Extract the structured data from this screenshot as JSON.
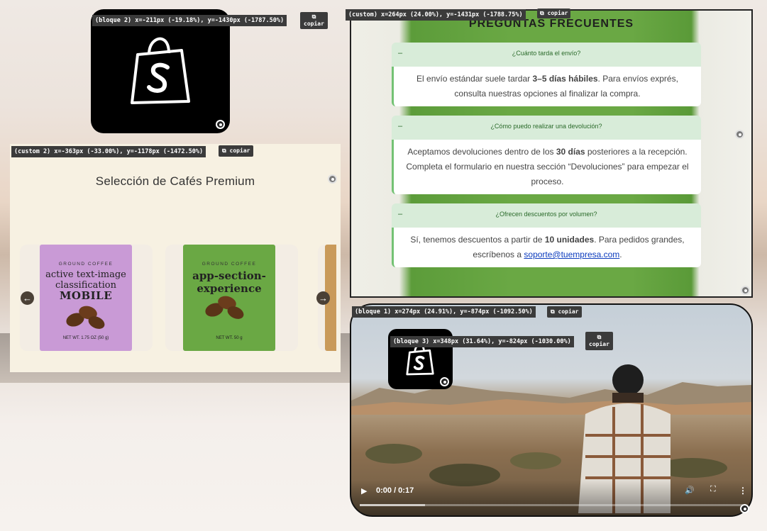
{
  "tags": {
    "logo_top": "(bloque 2) x=-211px (-19.18%), y=-1430px (-1787.50%)",
    "faq": "(custom) x=264px (24.00%), y=-1431px (-1788.75%)",
    "carousel": "(custom 2) x=-363px (-33.00%), y=-1178px (-1472.50%)",
    "video": "(bloque 1) x=274px (24.91%), y=-874px (-1092.50%)",
    "logo_small": "(bloque 3) x=348px (31.64%), y=-824px (-1030.00%)"
  },
  "copy_label": "copiar",
  "copy_icon": "⧉",
  "carousel": {
    "title": "Selección de Cafés Premium",
    "prev": "←",
    "next": "→",
    "products": [
      {
        "brand": "GROUND COFFEE",
        "line1": "active text-image",
        "line2": "classification",
        "line3": "MOBILE",
        "weight": "NET WT. 1.75 OZ (50 g)",
        "color": "#c99ad6"
      },
      {
        "brand": "GROUND COFFEE",
        "line1": "app-section-",
        "line2": "experience",
        "line3": "",
        "weight": "NET WT. 50 g",
        "color": "#6aa844"
      }
    ]
  },
  "faq": {
    "heading": "PREGUNTAS FRECUENTES",
    "items": [
      {
        "q": "¿Cuánto tarda el envío?",
        "a_pre": "El envío estándar suele tardar ",
        "a_bold": "3–5 días hábiles",
        "a_post": ". Para envíos exprés, consulta nuestras opciones al finalizar la compra."
      },
      {
        "q": "¿Cómo puedo realizar una devolución?",
        "a_pre": "Aceptamos devoluciones dentro de los ",
        "a_bold": "30 días",
        "a_post": " posteriores a la recepción. Completa el formulario en nuestra sección “Devoluciones” para empezar el proceso."
      },
      {
        "q": "¿Ofrecen descuentos por volumen?",
        "a_pre": "Sí, tenemos descuentos a partir de ",
        "a_bold": "10 unidades",
        "a_post": ". Para pedidos grandes, escríbenos a ",
        "a_link": "soporte@tuempresa.com",
        "a_end": "."
      }
    ]
  },
  "video": {
    "time": "0:00 / 0:17",
    "progress_buffered": 0.17
  },
  "colors": {
    "accent_green": "#74c274",
    "question_bg": "#d8ecd9",
    "link": "#0b3bbd"
  }
}
